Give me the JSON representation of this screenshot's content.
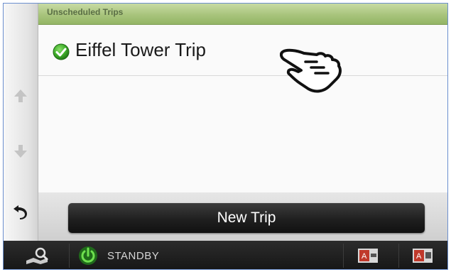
{
  "header": {
    "title": "Unscheduled Trips"
  },
  "trips": [
    {
      "label": "Eiffel Tower Trip",
      "status_icon": "green-check-icon"
    }
  ],
  "actions": {
    "new_trip_label": "New Trip"
  },
  "status_bar": {
    "standby_label": "STANDBY"
  },
  "icons": {
    "scroll_up": "arrow-up-icon",
    "scroll_down": "arrow-down-icon",
    "back": "back-arrow-icon",
    "pointer": "hand-pointer-icon"
  },
  "colors": {
    "header_green": "#a8c47c",
    "check_green": "#3fae2a",
    "frame_border": "#6b8fcf"
  }
}
